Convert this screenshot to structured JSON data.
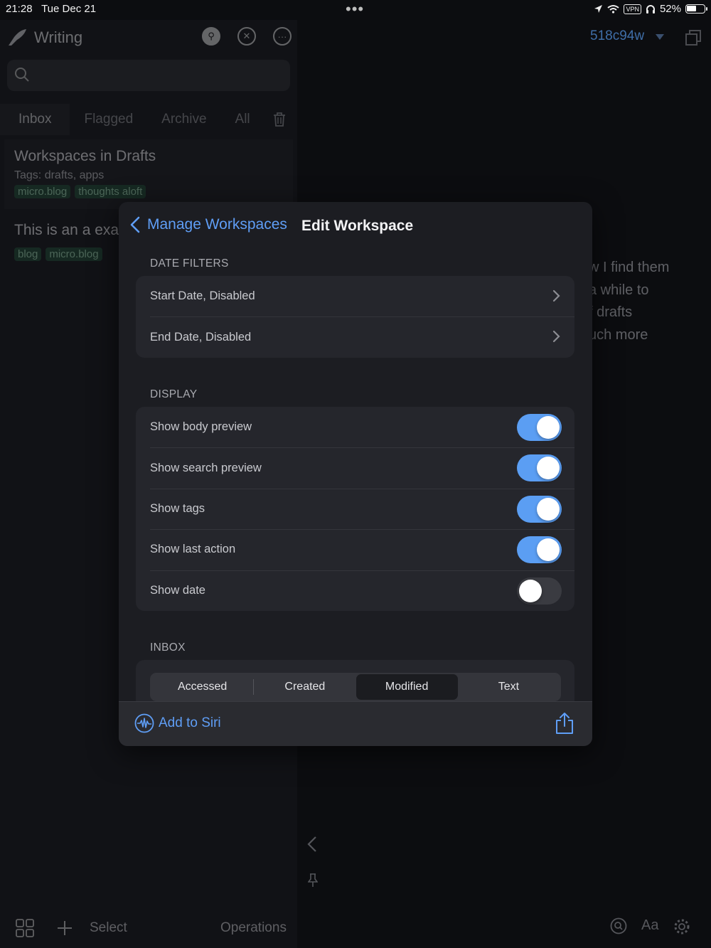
{
  "status_bar": {
    "time": "21:28",
    "date": "Tue Dec 21",
    "more_dots": "•••",
    "vpn": "VPN",
    "battery": "52%"
  },
  "sidebar": {
    "workspace_title": "Writing",
    "tabs": [
      "Inbox",
      "Flagged",
      "Archive",
      "All"
    ],
    "drafts": [
      {
        "title": "Workspaces in Drafts",
        "tags_line": "Tags:  drafts, apps",
        "chips": [
          "micro.blog",
          "thoughts aloft"
        ]
      },
      {
        "title": "This is an a exa",
        "chips": [
          "blog",
          "micro.blog"
        ]
      }
    ],
    "bottom": {
      "select": "Select",
      "operations": "Operations"
    }
  },
  "editor": {
    "hash": "518c94w",
    "body_lines": [
      "w I find them",
      "a while to",
      "f drafts",
      "uch more"
    ],
    "font_button": "Aa"
  },
  "modal": {
    "back_label": "Manage Workspaces",
    "title": "Edit Workspace",
    "date_filters": {
      "header": "DATE FILTERS",
      "rows": [
        "Start Date, Disabled",
        "End Date, Disabled"
      ]
    },
    "display": {
      "header": "DISPLAY",
      "rows": [
        {
          "label": "Show body preview",
          "on": true
        },
        {
          "label": "Show search preview",
          "on": true
        },
        {
          "label": "Show tags",
          "on": true
        },
        {
          "label": "Show last action",
          "on": true
        },
        {
          "label": "Show date",
          "on": false
        }
      ]
    },
    "inbox": {
      "header": "INBOX",
      "options": [
        "Accessed",
        "Created",
        "Modified",
        "Text"
      ],
      "selected": "Modified"
    },
    "footer": {
      "siri_label": "Add to Siri"
    }
  },
  "colors": {
    "accent": "#5f9ef6",
    "toggle_on": "#5b9ef3",
    "tag_chip": "#1f4a33"
  }
}
